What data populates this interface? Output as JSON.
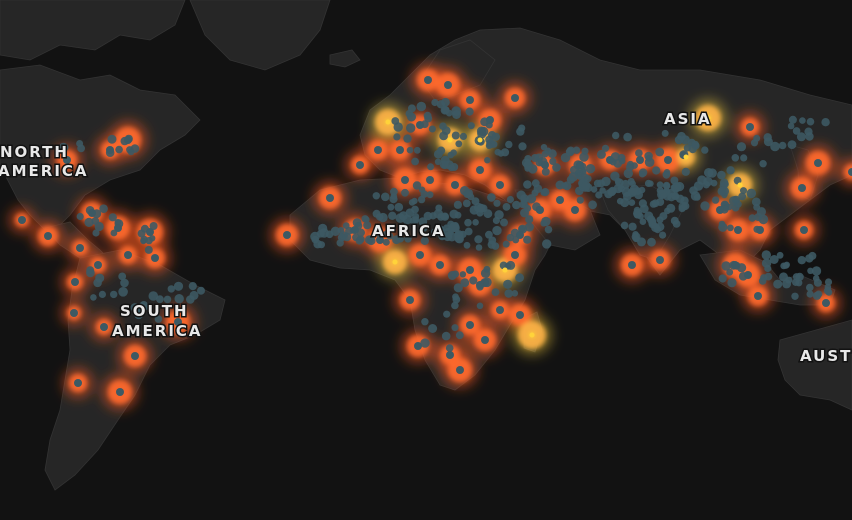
{
  "map": {
    "theme": "dark",
    "colors": {
      "ocean": "#121212",
      "land": "#262626",
      "border": "#3a3a3a",
      "glow": "#ff5a1f",
      "hot_core": "#ffd33a",
      "point": "#3d5963"
    },
    "labels": {
      "north_america_line1": "NORTH",
      "north_america_line2": "AMERICA",
      "south_america_line1": "SOUTH",
      "south_america_line2": "AMERICA",
      "africa": "AFRICA",
      "asia": "ASIA",
      "australia": "AUST"
    }
  }
}
